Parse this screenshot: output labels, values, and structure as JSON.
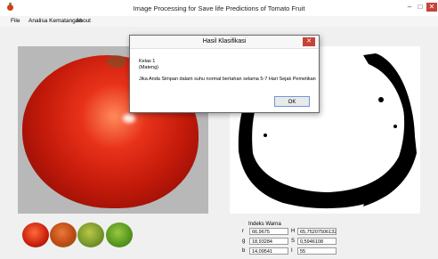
{
  "window": {
    "title": "Image Processing for Save life Predictions of Tomato Fruit",
    "minimize": "–",
    "maximize": "□",
    "close": "✕"
  },
  "menu": [
    "File",
    "Analisa Kematangan",
    "About"
  ],
  "indeks": {
    "title": "Indeks Warna",
    "r_label": "r",
    "r_value": "66,9675",
    "h_label": "H",
    "h_value": "65,7520750613271",
    "g_label": "g",
    "g_value": "18,93284",
    "s_label": "S",
    "s_value": "0,5946108",
    "b_label": "b",
    "b_value": "14,09541",
    "i_label": "I",
    "i_value": "55"
  },
  "dialog": {
    "title": "Hasil Klasifikasi",
    "close": "✕",
    "kelas": "Kelas 1",
    "status": "(Mateng)",
    "message": "Jika Anda Simpan dalam suhu normal bertahan selama 5-7 Hari Sejak Pemetikan",
    "ok": "OK"
  }
}
